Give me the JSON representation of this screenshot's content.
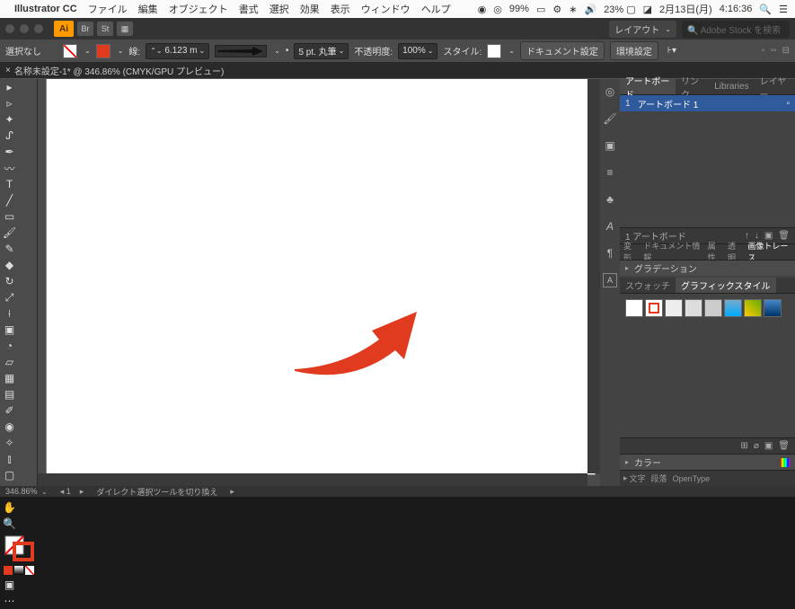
{
  "menubar": {
    "app": "Illustrator CC",
    "items": [
      "ファイル",
      "編集",
      "オブジェクト",
      "書式",
      "選択",
      "効果",
      "表示",
      "ウィンドウ",
      "ヘルプ"
    ],
    "battery": "23%",
    "date": "2月13日(月)",
    "time": "4:16:36",
    "mem": "99%"
  },
  "control": {
    "ai": "Ai",
    "br": "Br",
    "st": "St",
    "layout": "レイアウト",
    "search_placeholder": "Adobe Stock を検索"
  },
  "options": {
    "selection": "選択なし",
    "stroke_label": "線:",
    "stroke_width": "6.123 m",
    "stroke_end": "5 pt. 丸筆",
    "opacity_label": "不透明度:",
    "opacity": "100%",
    "style_label": "スタイル:",
    "doc_setup": "ドキュメント設定",
    "prefs": "環境設定"
  },
  "tab": {
    "title": "名称未設定-1* @ 346.86% (CMYK/GPU プレビュー)"
  },
  "panels": {
    "artboard_tabs": [
      "アートボード",
      "リンク",
      "Libraries",
      "レイヤー"
    ],
    "artboard_num": "1",
    "artboard_name": "アートボード 1",
    "artboard_count": "1 アートボード",
    "transform_row": [
      "変形",
      "ドキュメント情報",
      "属性",
      "透明",
      "画像トレース"
    ],
    "gradient": "グラデーション",
    "swatch_tabs": [
      "スウォッチ",
      "グラフィックスタイル"
    ],
    "color": "カラー",
    "type_row": [
      "文字",
      "段落",
      "OpenType"
    ]
  },
  "status": {
    "zoom": "346.86%",
    "artboard": "1",
    "tool": "ダイレクト選択ツールを切り換え"
  },
  "colors": {
    "accent": "#e03a1f"
  }
}
